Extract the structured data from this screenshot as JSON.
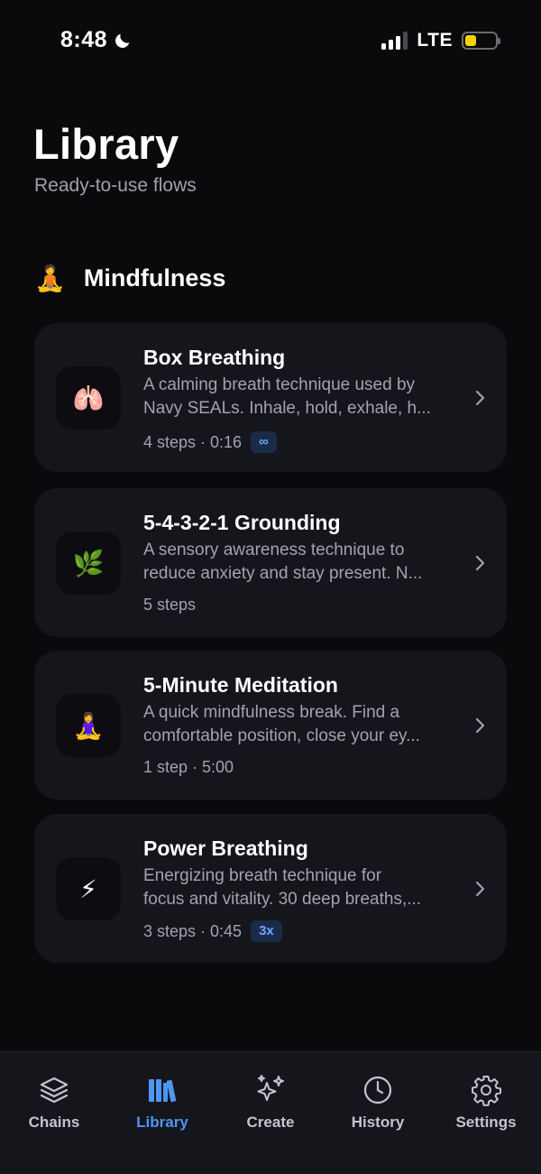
{
  "status_bar": {
    "time": "8:48",
    "network": "LTE",
    "battery_color": "#f5d200"
  },
  "header": {
    "title": "Library",
    "subtitle": "Ready-to-use flows"
  },
  "section": {
    "emoji": "🧘",
    "title": "Mindfulness"
  },
  "cards": [
    {
      "icon": "🫁",
      "icon_name": "lungs-icon",
      "title": "Box Breathing",
      "desc_line1": "A calming breath technique used by",
      "desc_line2": "Navy SEALs. Inhale, hold, exhale, h...",
      "meta": "4 steps · 0:16",
      "badge": "∞"
    },
    {
      "icon": "🌿",
      "icon_name": "herb-icon",
      "title": "5-4-3-2-1 Grounding",
      "desc_line1": "A sensory awareness technique to",
      "desc_line2": "reduce anxiety and stay present. N...",
      "meta": "5 steps",
      "badge": ""
    },
    {
      "icon": "🧘‍♀️",
      "icon_name": "meditation-icon",
      "title": "5-Minute Meditation",
      "desc_line1": "A quick mindfulness break. Find a",
      "desc_line2": "comfortable position, close your ey...",
      "meta": "1 step · 5:00",
      "badge": ""
    },
    {
      "icon": "⚡",
      "icon_name": "lightning-icon",
      "title": "Power Breathing",
      "desc_line1": "Energizing breath technique for",
      "desc_line2": "focus and vitality. 30 deep breaths,...",
      "meta": "3 steps · 0:45",
      "badge": "3x"
    }
  ],
  "tabs": [
    {
      "label": "Chains",
      "icon": "layers-icon",
      "active": false
    },
    {
      "label": "Library",
      "icon": "library-icon",
      "active": true
    },
    {
      "label": "Create",
      "icon": "sparkles-icon",
      "active": false
    },
    {
      "label": "History",
      "icon": "clock-icon",
      "active": false
    },
    {
      "label": "Settings",
      "icon": "gear-icon",
      "active": false
    }
  ],
  "colors": {
    "background": "#0a0a0d",
    "card": "#15161c",
    "accent": "#4f96f5",
    "badge_bg": "#1a2a48",
    "badge_text": "#6aa7ff",
    "secondary_text": "#a3a4ab"
  }
}
